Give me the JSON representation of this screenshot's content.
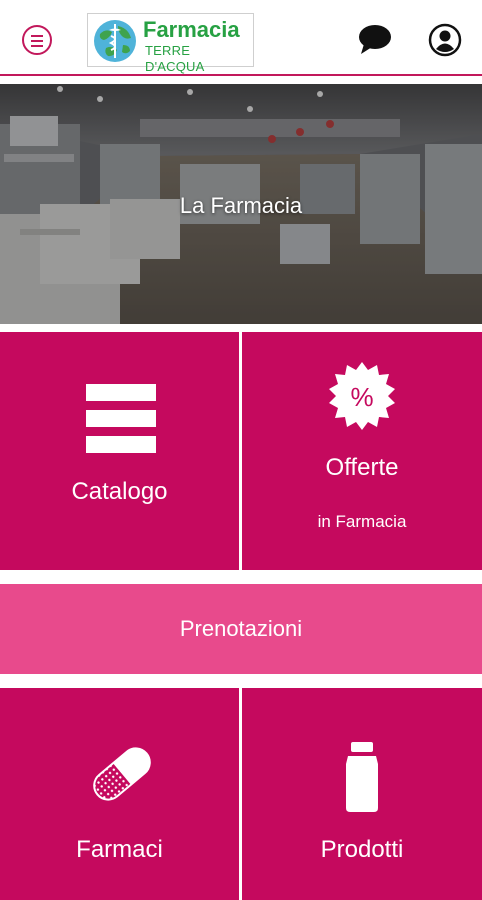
{
  "header": {
    "logo_title": "Farmacia",
    "logo_subtitle": "TERRE D'ACQUA",
    "icons": [
      "menu-icon",
      "chat-icon",
      "user-icon"
    ]
  },
  "hero": {
    "title": "La Farmacia"
  },
  "tiles": {
    "catalogo": {
      "label": "Catalogo",
      "icon": "list-icon"
    },
    "offerte": {
      "label": "Offerte",
      "sublabel": "in Farmacia",
      "icon": "percent-badge-icon"
    },
    "prenotazioni": {
      "label": "Prenotazioni"
    },
    "farmaci": {
      "label": "Farmaci",
      "icon": "pill-icon"
    },
    "prodotti": {
      "label": "Prodotti",
      "icon": "bottle-icon"
    }
  },
  "colors": {
    "accent": "#c5095e",
    "accent_light": "#e84a8c",
    "logo_green": "#27a143"
  }
}
